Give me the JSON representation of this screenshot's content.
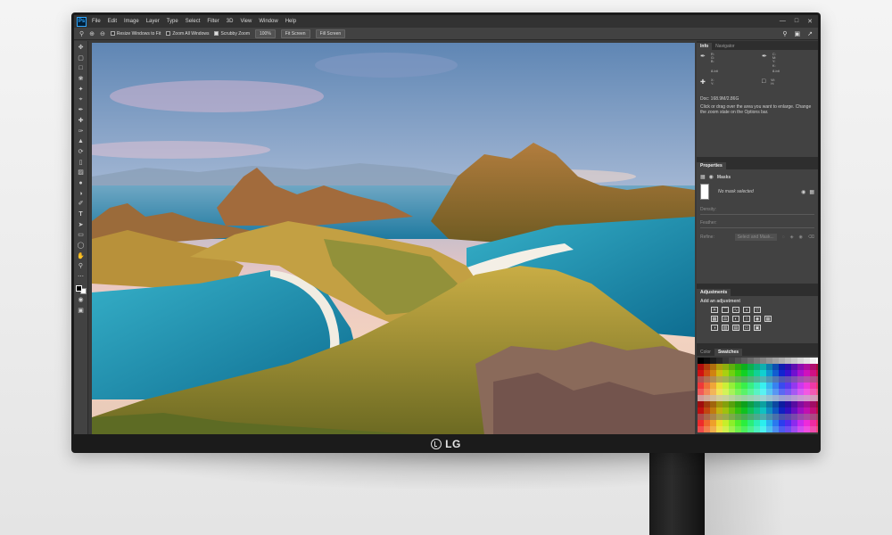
{
  "app": {
    "logo": "Ps",
    "menu": [
      "File",
      "Edit",
      "Image",
      "Layer",
      "Type",
      "Select",
      "Filter",
      "3D",
      "View",
      "Window",
      "Help"
    ],
    "window_controls": [
      "—",
      "□",
      "✕"
    ]
  },
  "options_bar": {
    "resize_windows_label": "Resize Windows to Fit",
    "zoom_all_label": "Zoom All Windows",
    "scrubby_zoom_label": "Scrubby Zoom",
    "zoom_value": "100%",
    "fit_screen_label": "Fit Screen",
    "fill_screen_label": "Fill Screen"
  },
  "panels": {
    "info_tab": "Info",
    "navigator_tab": "Navigator",
    "info_rgb": "R:\nG:\nB:",
    "info_cmyk": "C:\nM:\nY:\nK:",
    "bit_left": "8-bit",
    "bit_right": "8-bit",
    "info_xy": "X:\nY:",
    "info_wh": "W:\nH:",
    "doc_size": "Doc: 168.9M/2.86G",
    "hint": "Click or drag over the area you want to enlarge. Change the zoom state on the Options bar.",
    "properties_title": "Properties",
    "masks_label": "Masks",
    "no_mask": "No mask selected",
    "density_label": "Density:",
    "feather_label": "Feather:",
    "refine_label": "Refine:",
    "select_mask_label": "Select and Mask...",
    "adjustments_title": "Adjustments",
    "add_adjustment": "Add an adjustment",
    "color_tab": "Color",
    "swatches_tab": "Swatches"
  },
  "monitor": {
    "brand": "LG"
  },
  "colors": {
    "ui_dark": "#323232",
    "ui_panel": "#424242",
    "ps_blue": "#31a8ff"
  }
}
